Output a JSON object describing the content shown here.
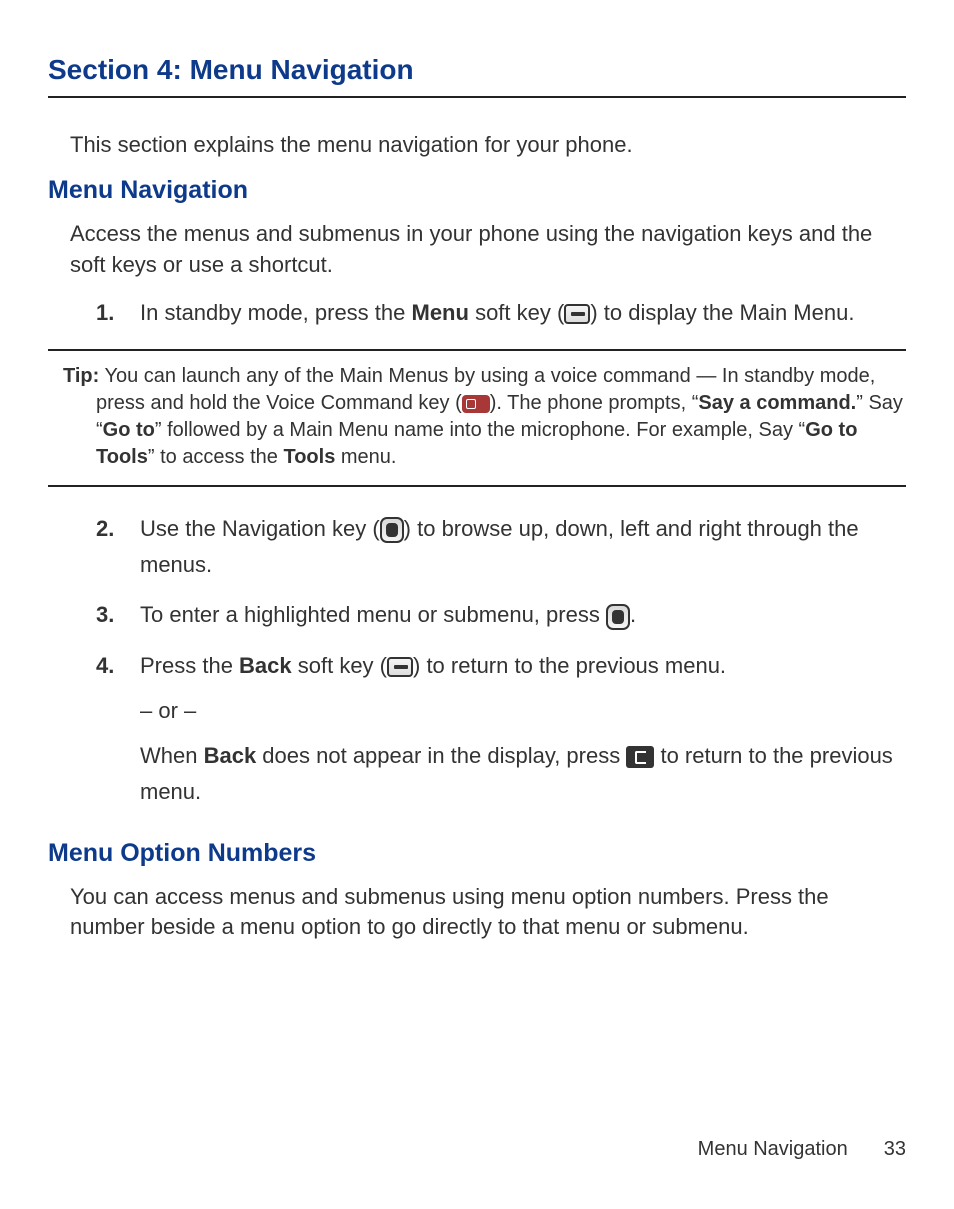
{
  "section_title": "Section 4: Menu Navigation",
  "intro": "This section explains the menu navigation for your phone.",
  "sub1": "Menu Navigation",
  "para1": "Access the menus and submenus in your phone using the navigation keys and the soft keys or use a shortcut.",
  "steps": {
    "n1": "1.",
    "s1a": "In standby mode, press the ",
    "s1b": "Menu",
    "s1c": " soft key (",
    "s1d": ") to display the Main Menu.",
    "n2": "2.",
    "s2a": "Use the Navigation key (",
    "s2b": ") to browse up, down, left and right through the menus.",
    "n3": "3.",
    "s3a": "To enter a highlighted menu or submenu, press ",
    "s3b": ".",
    "n4": "4.",
    "s4a": "Press the ",
    "s4b": "Back",
    "s4c": " soft key (",
    "s4d": ") to return to the previous menu.",
    "or": "– or –",
    "s4e": "When ",
    "s4f": "Back",
    "s4g": " does not appear in the display, press ",
    "s4h": " to return to the previous menu."
  },
  "tip": {
    "label": "Tip:",
    "t1": " You can launch any of the Main Menus by using a voice command — In standby mode, press and hold the Voice Command key (",
    "t2": "). The phone prompts, “",
    "t3": "Say a command.",
    "t4": "” Say “",
    "t5": "Go to",
    "t6": "” followed by a Main Menu name into the microphone. For example, Say “",
    "t7": "Go to Tools",
    "t8": "” to access the ",
    "t9": "Tools",
    "t10": " menu."
  },
  "sub2": "Menu Option Numbers",
  "para2": "You can access menus and submenus using menu option numbers. Press the number beside a menu option to go directly to that menu or submenu.",
  "footer": {
    "label": "Menu Navigation",
    "page": "33"
  }
}
